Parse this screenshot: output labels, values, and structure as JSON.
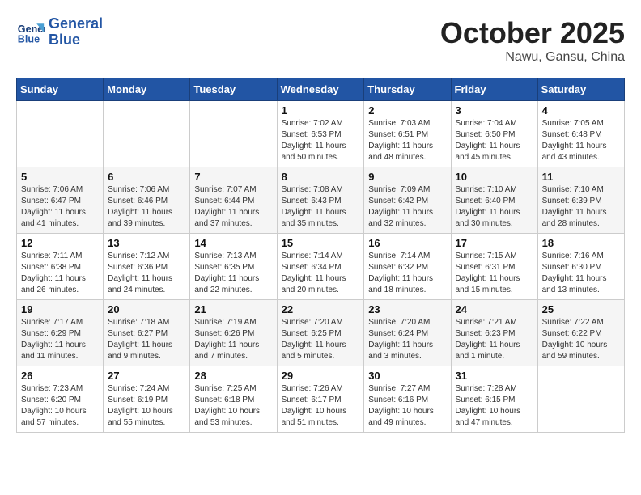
{
  "header": {
    "logo": {
      "line1": "General",
      "line2": "Blue"
    },
    "month": "October 2025",
    "location": "Nawu, Gansu, China"
  },
  "weekdays": [
    "Sunday",
    "Monday",
    "Tuesday",
    "Wednesday",
    "Thursday",
    "Friday",
    "Saturday"
  ],
  "weeks": [
    [
      {
        "day": "",
        "info": ""
      },
      {
        "day": "",
        "info": ""
      },
      {
        "day": "",
        "info": ""
      },
      {
        "day": "1",
        "info": "Sunrise: 7:02 AM\nSunset: 6:53 PM\nDaylight: 11 hours\nand 50 minutes."
      },
      {
        "day": "2",
        "info": "Sunrise: 7:03 AM\nSunset: 6:51 PM\nDaylight: 11 hours\nand 48 minutes."
      },
      {
        "day": "3",
        "info": "Sunrise: 7:04 AM\nSunset: 6:50 PM\nDaylight: 11 hours\nand 45 minutes."
      },
      {
        "day": "4",
        "info": "Sunrise: 7:05 AM\nSunset: 6:48 PM\nDaylight: 11 hours\nand 43 minutes."
      }
    ],
    [
      {
        "day": "5",
        "info": "Sunrise: 7:06 AM\nSunset: 6:47 PM\nDaylight: 11 hours\nand 41 minutes."
      },
      {
        "day": "6",
        "info": "Sunrise: 7:06 AM\nSunset: 6:46 PM\nDaylight: 11 hours\nand 39 minutes."
      },
      {
        "day": "7",
        "info": "Sunrise: 7:07 AM\nSunset: 6:44 PM\nDaylight: 11 hours\nand 37 minutes."
      },
      {
        "day": "8",
        "info": "Sunrise: 7:08 AM\nSunset: 6:43 PM\nDaylight: 11 hours\nand 35 minutes."
      },
      {
        "day": "9",
        "info": "Sunrise: 7:09 AM\nSunset: 6:42 PM\nDaylight: 11 hours\nand 32 minutes."
      },
      {
        "day": "10",
        "info": "Sunrise: 7:10 AM\nSunset: 6:40 PM\nDaylight: 11 hours\nand 30 minutes."
      },
      {
        "day": "11",
        "info": "Sunrise: 7:10 AM\nSunset: 6:39 PM\nDaylight: 11 hours\nand 28 minutes."
      }
    ],
    [
      {
        "day": "12",
        "info": "Sunrise: 7:11 AM\nSunset: 6:38 PM\nDaylight: 11 hours\nand 26 minutes."
      },
      {
        "day": "13",
        "info": "Sunrise: 7:12 AM\nSunset: 6:36 PM\nDaylight: 11 hours\nand 24 minutes."
      },
      {
        "day": "14",
        "info": "Sunrise: 7:13 AM\nSunset: 6:35 PM\nDaylight: 11 hours\nand 22 minutes."
      },
      {
        "day": "15",
        "info": "Sunrise: 7:14 AM\nSunset: 6:34 PM\nDaylight: 11 hours\nand 20 minutes."
      },
      {
        "day": "16",
        "info": "Sunrise: 7:14 AM\nSunset: 6:32 PM\nDaylight: 11 hours\nand 18 minutes."
      },
      {
        "day": "17",
        "info": "Sunrise: 7:15 AM\nSunset: 6:31 PM\nDaylight: 11 hours\nand 15 minutes."
      },
      {
        "day": "18",
        "info": "Sunrise: 7:16 AM\nSunset: 6:30 PM\nDaylight: 11 hours\nand 13 minutes."
      }
    ],
    [
      {
        "day": "19",
        "info": "Sunrise: 7:17 AM\nSunset: 6:29 PM\nDaylight: 11 hours\nand 11 minutes."
      },
      {
        "day": "20",
        "info": "Sunrise: 7:18 AM\nSunset: 6:27 PM\nDaylight: 11 hours\nand 9 minutes."
      },
      {
        "day": "21",
        "info": "Sunrise: 7:19 AM\nSunset: 6:26 PM\nDaylight: 11 hours\nand 7 minutes."
      },
      {
        "day": "22",
        "info": "Sunrise: 7:20 AM\nSunset: 6:25 PM\nDaylight: 11 hours\nand 5 minutes."
      },
      {
        "day": "23",
        "info": "Sunrise: 7:20 AM\nSunset: 6:24 PM\nDaylight: 11 hours\nand 3 minutes."
      },
      {
        "day": "24",
        "info": "Sunrise: 7:21 AM\nSunset: 6:23 PM\nDaylight: 11 hours\nand 1 minute."
      },
      {
        "day": "25",
        "info": "Sunrise: 7:22 AM\nSunset: 6:22 PM\nDaylight: 10 hours\nand 59 minutes."
      }
    ],
    [
      {
        "day": "26",
        "info": "Sunrise: 7:23 AM\nSunset: 6:20 PM\nDaylight: 10 hours\nand 57 minutes."
      },
      {
        "day": "27",
        "info": "Sunrise: 7:24 AM\nSunset: 6:19 PM\nDaylight: 10 hours\nand 55 minutes."
      },
      {
        "day": "28",
        "info": "Sunrise: 7:25 AM\nSunset: 6:18 PM\nDaylight: 10 hours\nand 53 minutes."
      },
      {
        "day": "29",
        "info": "Sunrise: 7:26 AM\nSunset: 6:17 PM\nDaylight: 10 hours\nand 51 minutes."
      },
      {
        "day": "30",
        "info": "Sunrise: 7:27 AM\nSunset: 6:16 PM\nDaylight: 10 hours\nand 49 minutes."
      },
      {
        "day": "31",
        "info": "Sunrise: 7:28 AM\nSunset: 6:15 PM\nDaylight: 10 hours\nand 47 minutes."
      },
      {
        "day": "",
        "info": ""
      }
    ]
  ]
}
